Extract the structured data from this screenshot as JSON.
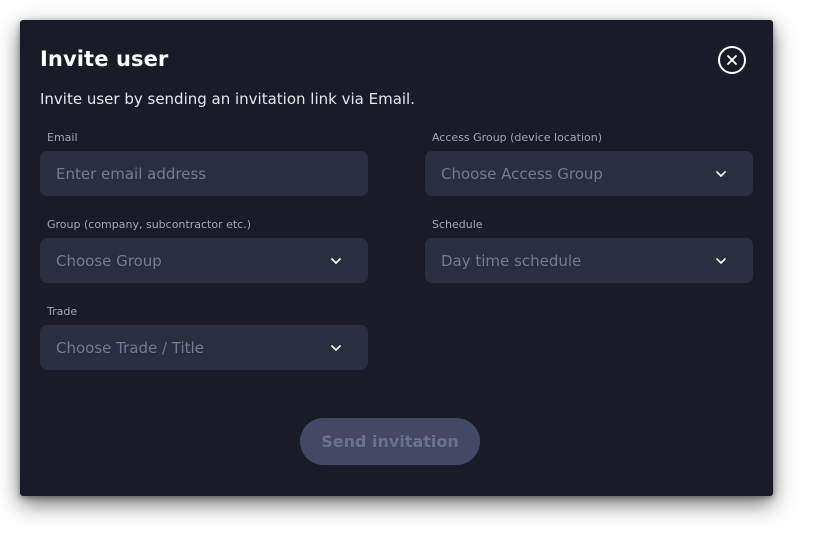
{
  "dialog": {
    "title": "Invite user",
    "subtitle": "Invite user by sending an invitation link via Email.",
    "close_icon": "close-icon"
  },
  "fields": {
    "email": {
      "label": "Email",
      "placeholder": "Enter email address"
    },
    "access_group": {
      "label": "Access Group (device location)",
      "value": "Choose Access Group",
      "icon": "chevron-down-icon"
    },
    "group": {
      "label": "Group (company, subcontractor etc.)",
      "value": "Choose Group",
      "icon": "chevron-down-icon"
    },
    "schedule": {
      "label": "Schedule",
      "value": "Day time schedule",
      "icon": "chevron-down-icon"
    },
    "trade": {
      "label": "Trade",
      "value": "Choose Trade / Title",
      "icon": "chevron-down-icon"
    }
  },
  "actions": {
    "send_label": "Send invitation",
    "send_disabled": true
  },
  "colors": {
    "dialog_bg": "#1a1b27",
    "field_bg": "#2b2d40",
    "placeholder": "#737996",
    "label": "#a3a6b4",
    "button_bg": "#434865",
    "button_text": "#6a7090"
  }
}
